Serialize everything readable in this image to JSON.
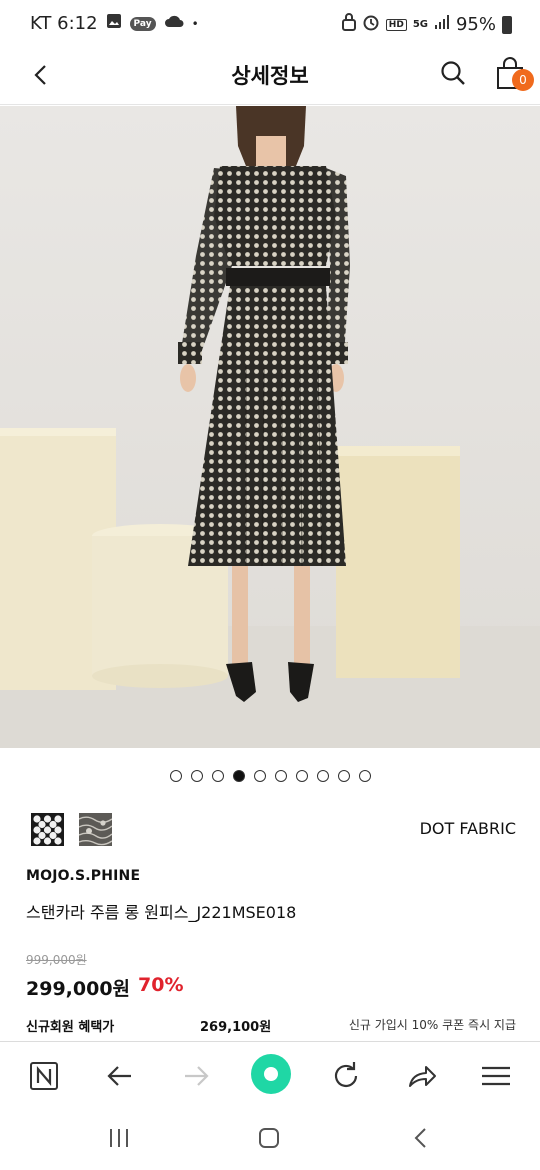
{
  "status_bar": {
    "carrier_time": "KT 6:12",
    "pay_label": "Pay",
    "dot": "•",
    "hd_label": "HD",
    "network": "5G",
    "battery": "95%"
  },
  "header": {
    "title": "상세정보",
    "cart_count": "0"
  },
  "gallery": {
    "total": 10,
    "active_index": 3
  },
  "product": {
    "fabric_label": "DOT FABRIC",
    "brand": "MOJO.S.PHINE",
    "name": "스탠카라 주름 롱 원피스_J221MSE018",
    "original_price": "999,000원",
    "sale_price": "299,000원",
    "discount": "70%",
    "member_label": "신규회원 혜택가",
    "member_price": "269,100원",
    "member_note": "신규 가입시 10% 쿠폰 즉시 지급"
  },
  "colors": {
    "accent_orange": "#f06a1d",
    "discount_red": "#e0232d",
    "home_green": "#1fd7a5"
  }
}
